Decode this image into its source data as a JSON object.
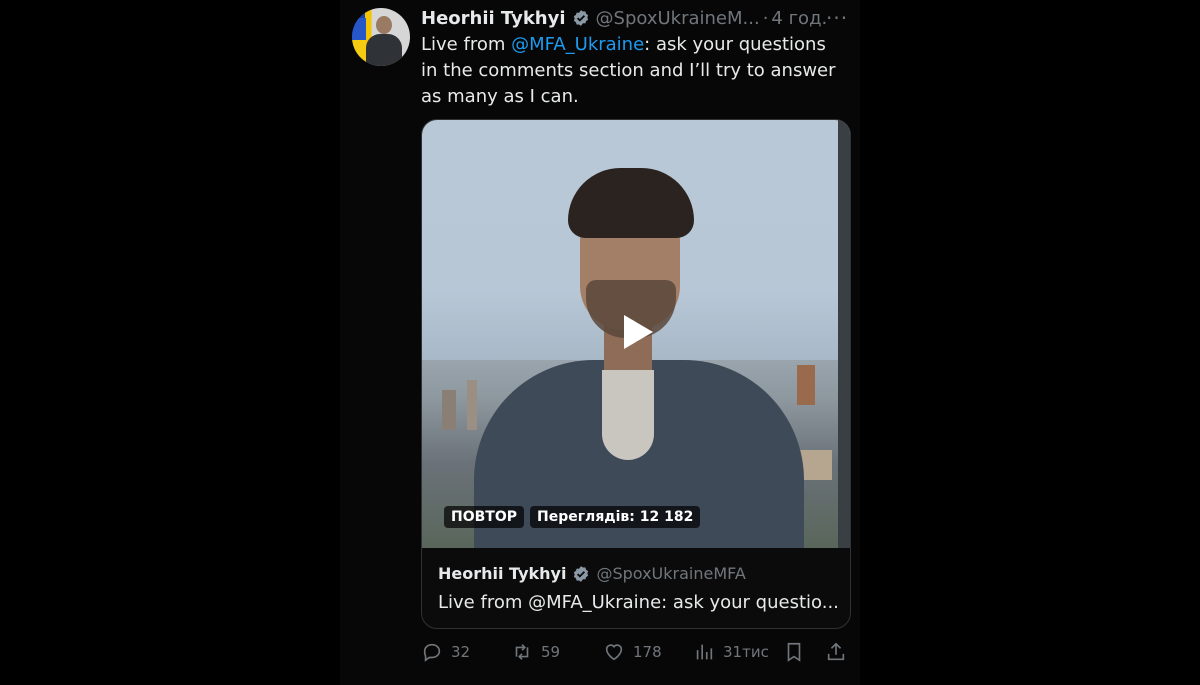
{
  "tweet": {
    "author_name": "Heorhii Tykhyi",
    "handle": "@SpoxUkraineM...",
    "separator": "·",
    "time": "4 год.",
    "more": "···",
    "text_prefix": "Live from ",
    "mention": "@MFA_Ukraine",
    "text_suffix": ": ask your questions in the comments section and I’ll try to answer as many as I can."
  },
  "card": {
    "replay_badge": "ПОВТОР",
    "views_badge": "Переглядів: 12 182",
    "quote_author": "Heorhii Tykhyi",
    "quote_handle": "@SpoxUkraineMFA",
    "quote_text": "Live from @MFA_Ukraine: ask your questio..."
  },
  "actions": {
    "replies": "32",
    "reposts": "59",
    "likes": "178",
    "views": "31тис"
  },
  "colors": {
    "accent": "#1d9bf0",
    "muted": "#71767b",
    "text": "#e7e9ea"
  }
}
